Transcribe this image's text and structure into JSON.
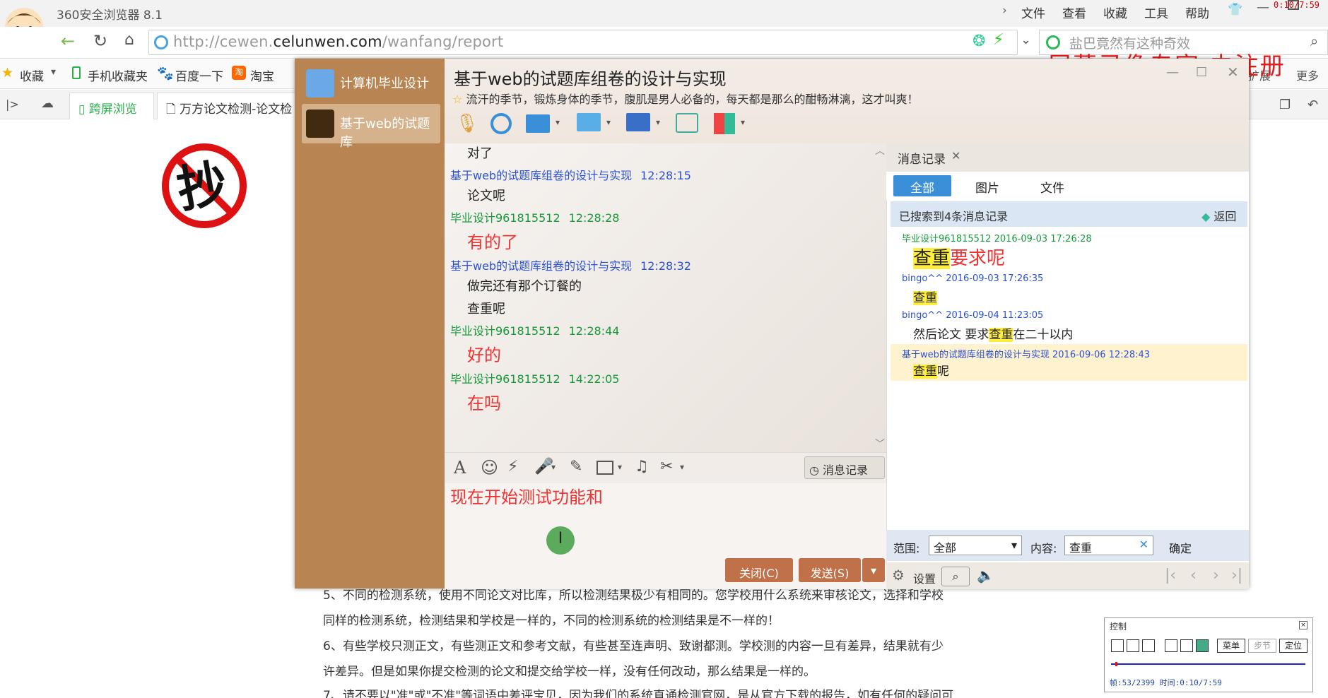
{
  "browser": {
    "app_title": "360安全浏览器 8.1",
    "menu": [
      "文件",
      "查看",
      "收藏",
      "工具",
      "帮助"
    ],
    "record_time": "0:10/7:59",
    "url_prefix": "http://cewen.",
    "url_domain": "celunwen.com",
    "url_path": "/wanfang/report",
    "search_placeholder": "盐巴竟然有这种奇效",
    "bookmarks": [
      "收藏",
      "手机收藏夹",
      "百度一下",
      "淘宝"
    ],
    "right_labels": [
      "扩展",
      "更多"
    ],
    "tabs": [
      "跨屏浏览",
      "万方论文检测-论文检"
    ]
  },
  "watermark": "屏幕录像专家 未注册",
  "page": {
    "no_copy_char": "抄",
    "lines": [
      "5、不同的检测系统，使用不同论文对比库，所以检测结果极少有相同的。您学校用什么系统来审核论文，选择和学校",
      "同样的检测系统，检测结果和学校是一样的，不同的检测系统的检测结果是不一样的！",
      "6、有些学校只测正文，有些测正文和参考文献，有些甚至连声明、致谢都测。学校测的内容一旦有差异，结果就有少",
      "许差异。但是如果你提交检测的论文和提交给学校一样，没有任何改动，那么结果是一样的。",
      "7、请不要以\"准\"或\"不准\"等词语中差评宝贝，因为我们的系统直通检测官网，是从官方下载的报告，如有任何的疑问可"
    ]
  },
  "chat": {
    "contacts": [
      "计算机毕业设计",
      "基于web的试题库"
    ],
    "title": "基于web的试题库组卷的设计与实现",
    "signature": "流汗的季节，锻炼身体的季节，腹肌是男人必备的，每天都是那么的酣畅淋漓，这才叫爽！",
    "messages": [
      {
        "kind": "text",
        "text": "对了"
      },
      {
        "kind": "head",
        "sender": "基于web的试题库组卷的设计与实现",
        "time": "12:28:15",
        "color": "#2b51d6"
      },
      {
        "kind": "text",
        "text": "论文呢"
      },
      {
        "kind": "head",
        "sender": "毕业设计961815512",
        "time": "12:28:28",
        "color": "#159a3a"
      },
      {
        "kind": "big",
        "text": "有的了"
      },
      {
        "kind": "head",
        "sender": "基于web的试题库组卷的设计与实现",
        "time": "12:28:32",
        "color": "#2b51d6"
      },
      {
        "kind": "text",
        "text": "做完还有那个订餐的"
      },
      {
        "kind": "text",
        "text": "查重呢"
      },
      {
        "kind": "head",
        "sender": "毕业设计961815512",
        "time": "12:28:44",
        "color": "#159a3a"
      },
      {
        "kind": "big",
        "text": "好的"
      },
      {
        "kind": "head",
        "sender": "毕业设计961815512",
        "time": "14:22:05",
        "color": "#159a3a"
      },
      {
        "kind": "big",
        "text": "在吗"
      }
    ],
    "history_button": "消息记录",
    "input_text": "现在开始测试功能和",
    "close_button": "关闭(C)",
    "send_button": "发送(S)"
  },
  "history": {
    "panel_title": "消息记录",
    "tabs": [
      "全部",
      "图片",
      "文件"
    ],
    "result_info": "已搜索到4条消息记录",
    "back": "返回",
    "entries": [
      {
        "head": "毕业设计961815512 2016-09-03 17:26:28",
        "head_color": "#159a3a",
        "pre": "",
        "hl": "查重",
        "post": "要求呢",
        "size": "26px",
        "post_color": "#e33"
      },
      {
        "head": "bingo^^ 2016-09-03 17:26:35",
        "head_color": "#2b51d6",
        "pre": "",
        "hl": "查重",
        "post": "",
        "size": "17px",
        "post_color": "#222"
      },
      {
        "head": "bingo^^ 2016-09-04 11:23:05",
        "head_color": "#2b51d6",
        "pre": "然后论文  要求",
        "hl": "查重",
        "post": "在二十以内",
        "size": "17px",
        "post_color": "#222"
      },
      {
        "head": "基于web的试题库组卷的设计与实现 2016-09-06 12:28:43",
        "head_color": "#2b51d6",
        "pre": "",
        "hl": "查重",
        "post": "呢",
        "size": "17px",
        "post_color": "#222",
        "selected": true
      }
    ],
    "range_label": "范围:",
    "range_value": "全部",
    "content_label": "内容:",
    "content_value": "查重",
    "confirm": "确定",
    "settings": "设置"
  },
  "control": {
    "title": "控制",
    "menu_btn": "菜单",
    "step_btn": "步节",
    "locate_btn": "定位",
    "status": "帧:53/2399 时间:0:10/7:59"
  }
}
